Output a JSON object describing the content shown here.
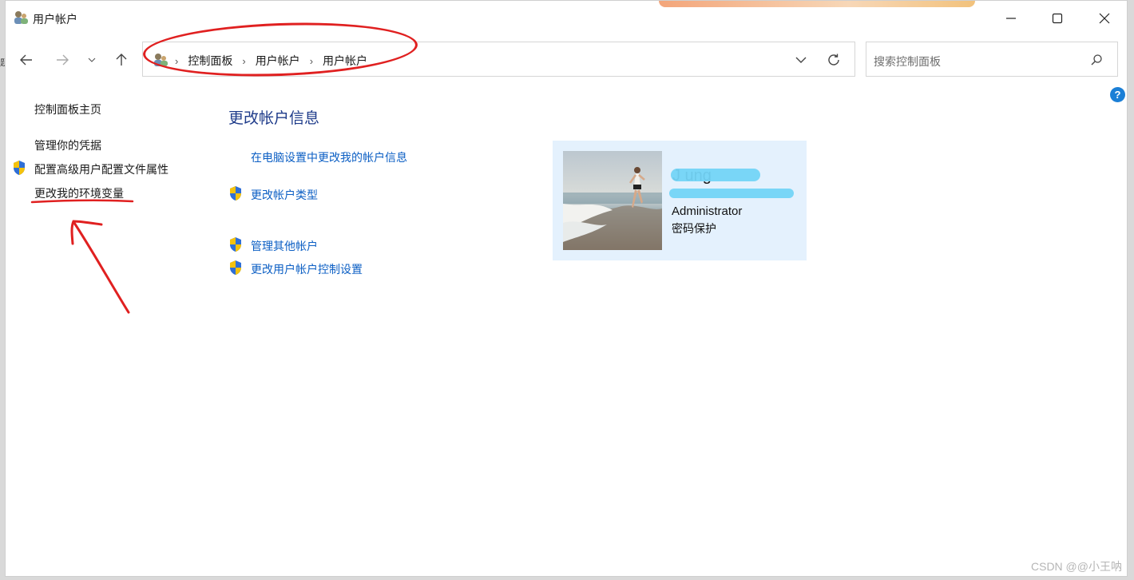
{
  "window": {
    "title": "用户帐户",
    "controls": {
      "minimize": "minimize",
      "maximize": "maximize",
      "close": "close"
    }
  },
  "left_edge_char": "题",
  "address": {
    "breadcrumbs": [
      "控制面板",
      "用户帐户",
      "用户帐户"
    ],
    "dropdown_icon": "chevron-down-icon",
    "refresh_icon": "refresh-icon"
  },
  "search": {
    "placeholder": "搜索控制面板",
    "icon": "search-icon"
  },
  "help_label": "?",
  "sidebar": {
    "home": "控制面板主页",
    "items": [
      {
        "label": "管理你的凭据",
        "shield": false
      },
      {
        "label": "配置高级用户配置文件属性",
        "shield": true
      },
      {
        "label": "更改我的环境变量",
        "shield": false
      }
    ]
  },
  "main": {
    "title": "更改帐户信息",
    "links": [
      {
        "label": "在电脑设置中更改我的帐户信息",
        "shield": false
      },
      {
        "label": "更改帐户类型",
        "shield": true
      },
      {
        "label": "管理其他帐户",
        "shield": true
      },
      {
        "label": "更改用户帐户控制设置",
        "shield": true
      }
    ]
  },
  "account": {
    "name": "J      ung",
    "email": "",
    "role": "Administrator",
    "password_status": "密码保护"
  },
  "watermark": "CSDN @@小王呐",
  "colors": {
    "link": "#0c5fc4",
    "heading": "#1e3b8a",
    "card_bg": "#e4f1fd",
    "annotation_red": "#e02020",
    "help_blue": "#1b7fd6"
  }
}
